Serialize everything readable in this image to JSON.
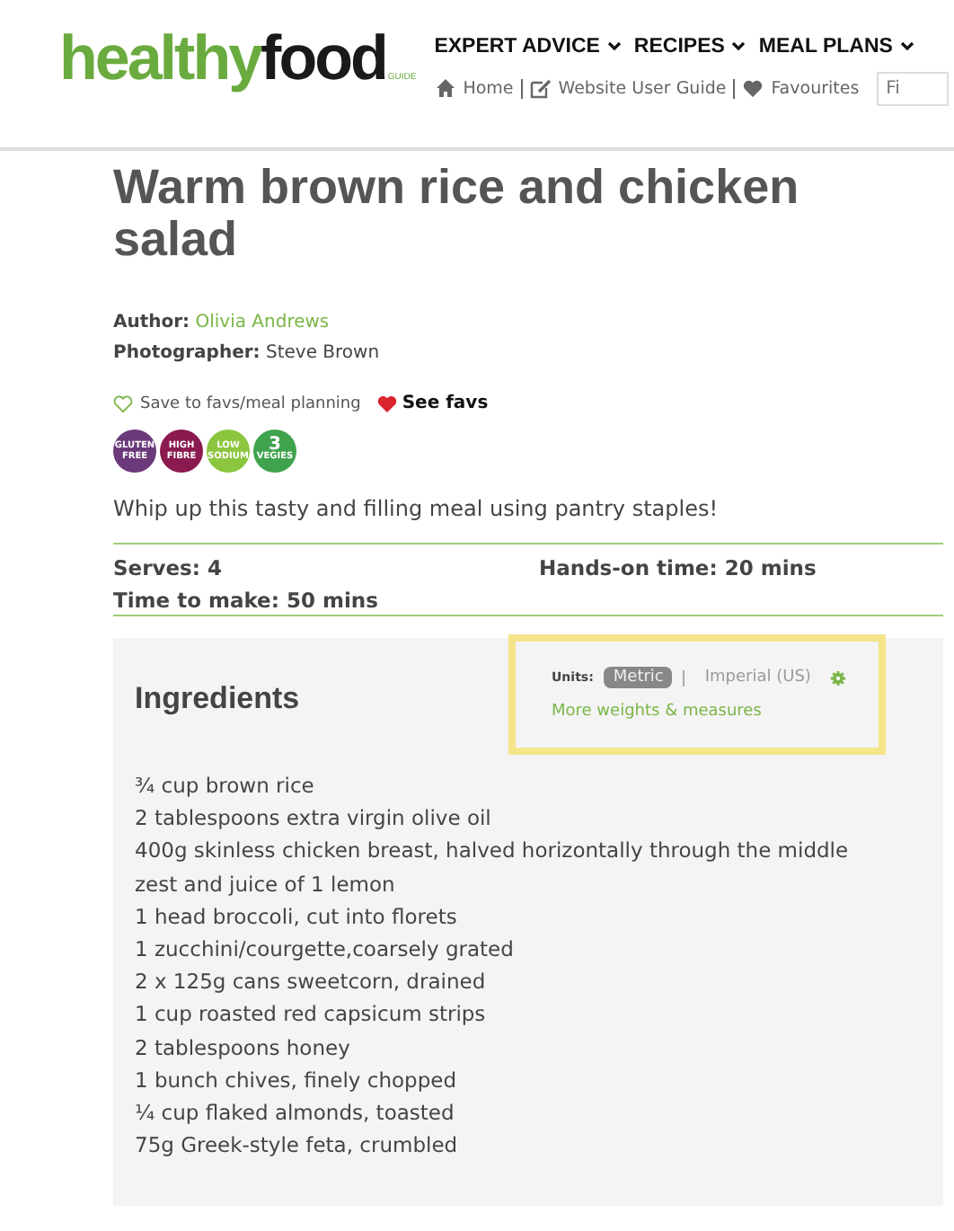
{
  "header": {
    "logo": {
      "part1": "healthy",
      "part2": "food",
      "tag": "GUIDE"
    },
    "nav": [
      {
        "label": "EXPERT ADVICE"
      },
      {
        "label": "RECIPES"
      },
      {
        "label": "MEAL PLANS"
      }
    ],
    "links": [
      {
        "kind": "home",
        "label": "Home"
      },
      {
        "kind": "edit",
        "label": "Website User Guide"
      },
      {
        "kind": "heart",
        "label": "Favourites"
      }
    ],
    "search": {
      "placeholder": "Fi"
    }
  },
  "title": "Warm brown rice and chicken salad",
  "credits": [
    {
      "label": "Author:",
      "value": "Olivia Andrews",
      "link": true
    },
    {
      "label": "Photographer:",
      "value": "Steve Brown",
      "link": false
    }
  ],
  "save": {
    "label": "Save to favs/meal planning",
    "see": "See favs"
  },
  "badges": [
    {
      "lines": [
        "GLUTEN",
        "FREE"
      ],
      "color": "#6b3a7a"
    },
    {
      "lines": [
        "HIGH",
        "FIBRE"
      ],
      "color": "#8a1a4f"
    },
    {
      "lines": [
        "LOW",
        "SODIUM"
      ],
      "color": "#8cc63f"
    },
    {
      "lines": [
        "3",
        "VEGIES"
      ],
      "color": "#3fa34d"
    }
  ],
  "intro": "Whip up this tasty and filling meal using pantry staples!",
  "facts": [
    {
      "label": "Serves: 4"
    },
    {
      "label": "Hands-on time: 20 mins"
    },
    {
      "label": "Time to make: 50 mins"
    }
  ],
  "ingredients": {
    "heading": "Ingredients",
    "units_label": "Units:",
    "units": [
      {
        "label": "Metric",
        "selected": true
      },
      {
        "label": "Imperial (US)",
        "selected": false
      }
    ],
    "more": "More weights & measures",
    "items": [
      "¾ cup brown rice",
      "2 tablespoons extra virgin olive oil",
      "400g skinless chicken breast, halved horizontally through the middle",
      "zest and juice of 1 lemon",
      "1 head broccoli, cut into florets",
      "1 zucchini/courgette,coarsely grated",
      "2 x 125g cans sweetcorn, drained",
      "1 cup roasted red capsicum strips",
      "2 tablespoons honey",
      "1 bunch chives, finely chopped",
      "¼ cup flaked almonds, toasted",
      "75g Greek-style feta, crumbled"
    ]
  }
}
